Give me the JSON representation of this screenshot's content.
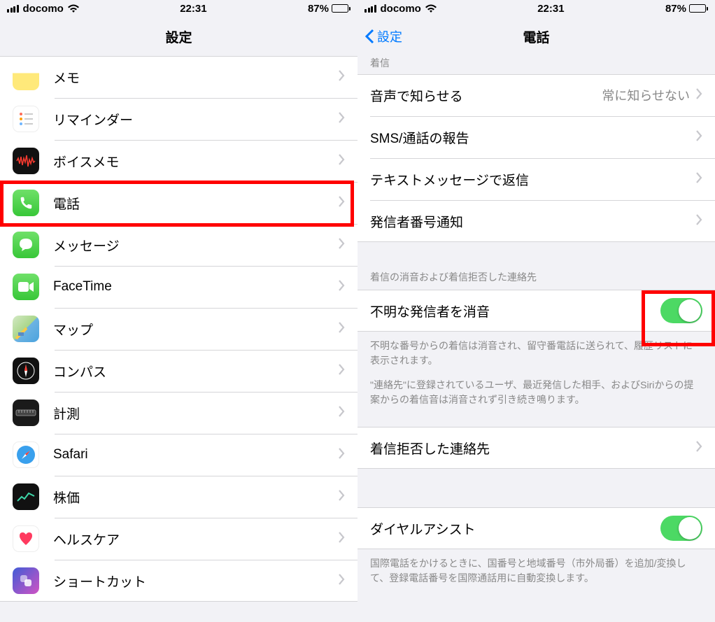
{
  "statusBar": {
    "carrier": "docomo",
    "time": "22:31",
    "batteryPct": "87%",
    "batteryFill": 87
  },
  "left": {
    "title": "設定",
    "items": [
      {
        "label": "メモ",
        "icon": "notes"
      },
      {
        "label": "リマインダー",
        "icon": "reminders"
      },
      {
        "label": "ボイスメモ",
        "icon": "voicememo"
      },
      {
        "label": "電話",
        "icon": "phone",
        "highlighted": true
      },
      {
        "label": "メッセージ",
        "icon": "messages"
      },
      {
        "label": "FaceTime",
        "icon": "facetime"
      },
      {
        "label": "マップ",
        "icon": "maps"
      },
      {
        "label": "コンパス",
        "icon": "compass"
      },
      {
        "label": "計測",
        "icon": "measure"
      },
      {
        "label": "Safari",
        "icon": "safari"
      },
      {
        "label": "株価",
        "icon": "stocks"
      },
      {
        "label": "ヘルスケア",
        "icon": "health"
      },
      {
        "label": "ショートカット",
        "icon": "shortcuts"
      }
    ]
  },
  "right": {
    "back": "設定",
    "title": "電話",
    "sectionTruncated": "着信",
    "group1": [
      {
        "label": "音声で知らせる",
        "detail": "常に知らせない"
      },
      {
        "label": "SMS/通話の報告"
      },
      {
        "label": "テキストメッセージで返信"
      },
      {
        "label": "発信者番号通知"
      }
    ],
    "section2Header": "着信の消音および着信拒否した連絡先",
    "silenceRow": {
      "label": "不明な発信者を消音",
      "on": true,
      "highlighted": true
    },
    "silenceFooter1": "不明な番号からの着信は消音され、留守番電話に送られて、履歴リストに表示されます。",
    "silenceFooter2": "\"連絡先\"に登録されているユーザ、最近発信した相手、およびSiriからの提案からの着信音は消音されず引き続き鳴ります。",
    "blockedRow": {
      "label": "着信拒否した連絡先"
    },
    "dialAssist": {
      "label": "ダイヤルアシスト",
      "on": true
    },
    "dialFooter": "国際電話をかけるときに、国番号と地域番号（市外局番）を追加/変換して、登録電話番号を国際通話用に自動変換します。"
  }
}
